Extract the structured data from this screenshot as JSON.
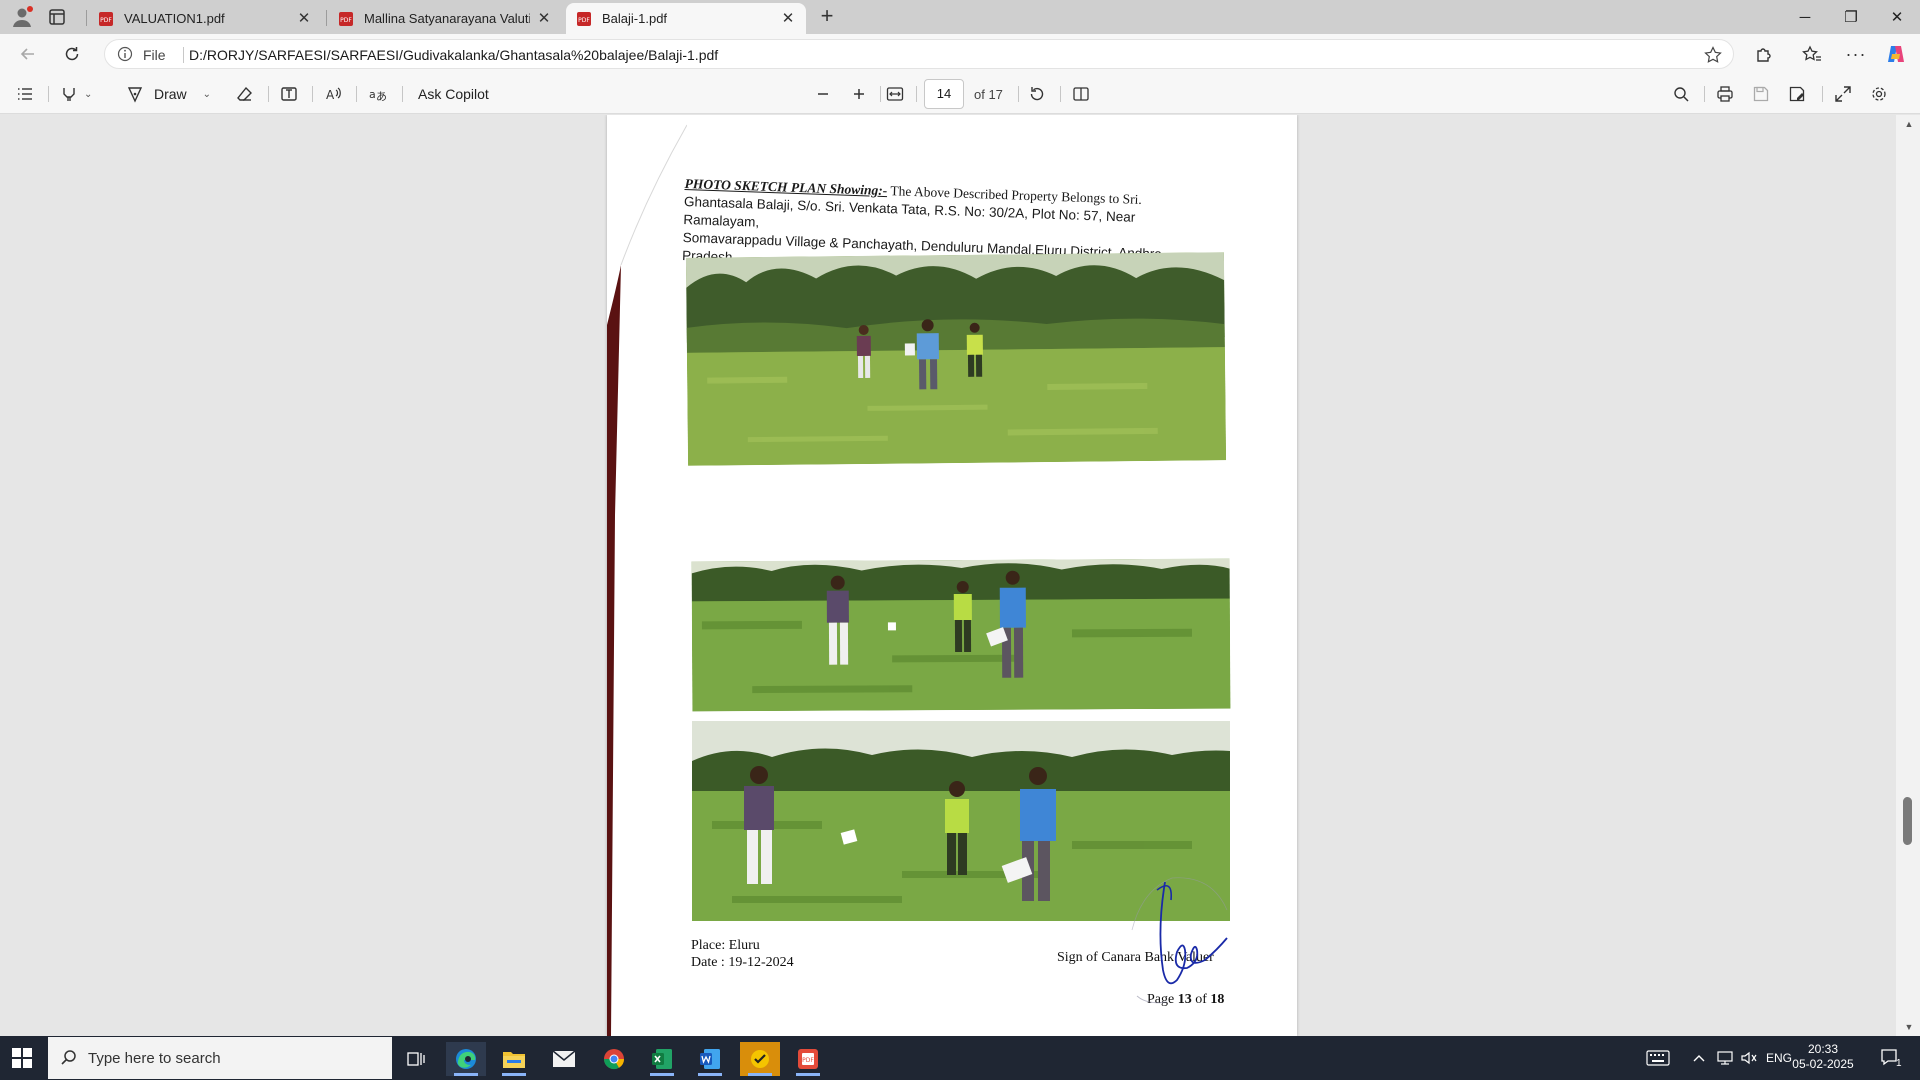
{
  "tabs": [
    {
      "label": "VALUATION1.pdf",
      "active": false
    },
    {
      "label": "Mallina Satyanarayana Valution.pdf",
      "active": false
    },
    {
      "label": "Balaji-1.pdf",
      "active": true
    }
  ],
  "address_bar": {
    "scheme_label": "File",
    "url": "D:/RORJY/SARFAESI/SARFAESI/Gudivakalanka/Ghantasala%20balajee/Balaji-1.pdf"
  },
  "pdf_toolbar": {
    "draw_label": "Draw",
    "ask_copilot_label": "Ask Copilot",
    "current_page": "14",
    "page_total_label": "of 17"
  },
  "document": {
    "heading_bold": "PHOTO SKETCH PLAN Showing:-",
    "heading_rest": " The Above Described Property Belongs to Sri.",
    "heading_line2": "Ghantasala Balaji, S/o. Sri. Venkata Tata, R.S. No: 30/2A, Plot No: 57, Near Ramalayam,",
    "heading_line3": "Somavarappadu Village & Panchayath, Denduluru Mandal,Eluru District, Andhra Pradesh.",
    "place_line": "Place: Eluru",
    "date_line": "Date : 19-12-2024",
    "sign_line": "Sign of Canara Bank Valuer",
    "page_footer_prefix": "Page ",
    "page_footer_num": "13",
    "page_footer_mid": " of ",
    "page_footer_total": "18"
  },
  "taskbar": {
    "search_placeholder": "Type here to search",
    "language": "ENG",
    "time": "20:33",
    "date": "05-02-2025",
    "notification_count": "1"
  },
  "colors": {
    "accent": "#0078d4",
    "grass": "#6f9a3a",
    "trees": "#3d5a2a",
    "taskbar": "#1f2633"
  }
}
